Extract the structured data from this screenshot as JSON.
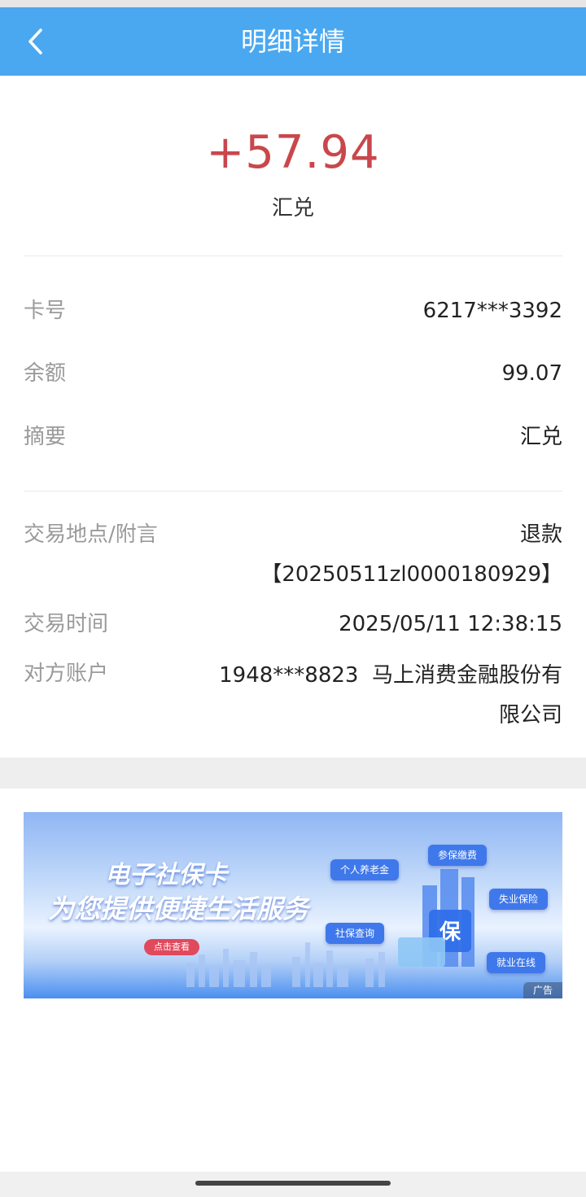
{
  "header": {
    "title": "明细详情"
  },
  "summary": {
    "amount": "+57.94",
    "type": "汇兑"
  },
  "details": [
    {
      "label": "卡号",
      "value": "6217***3392"
    },
    {
      "label": "余额",
      "value": "99.07"
    },
    {
      "label": "摘要",
      "value": "汇兑"
    }
  ],
  "transaction": {
    "location_label": "交易地点/附言",
    "location_value_line1": "退款",
    "location_value_line2": "【20250511zl0000180929】",
    "time_label": "交易时间",
    "time_value": "2025/05/11 12:38:15",
    "counterparty_label": "对方账户",
    "counterparty_value_line1": "1948***8823  马上消费金融股份有",
    "counterparty_value_line2": "限公司"
  },
  "banner": {
    "title_line1": "电子社保卡",
    "title_line2": "为您提供便捷生活服务",
    "cta": "点击查看",
    "bubbles": [
      "个人养老金",
      "参保缴费",
      "失业保险",
      "社保查询",
      "就业在线"
    ],
    "ad_tag": "广告"
  },
  "colors": {
    "nav_bg": "#4aa8f1",
    "amount": "#c9474c"
  },
  "icons": {
    "back": "chevron-left-icon"
  }
}
